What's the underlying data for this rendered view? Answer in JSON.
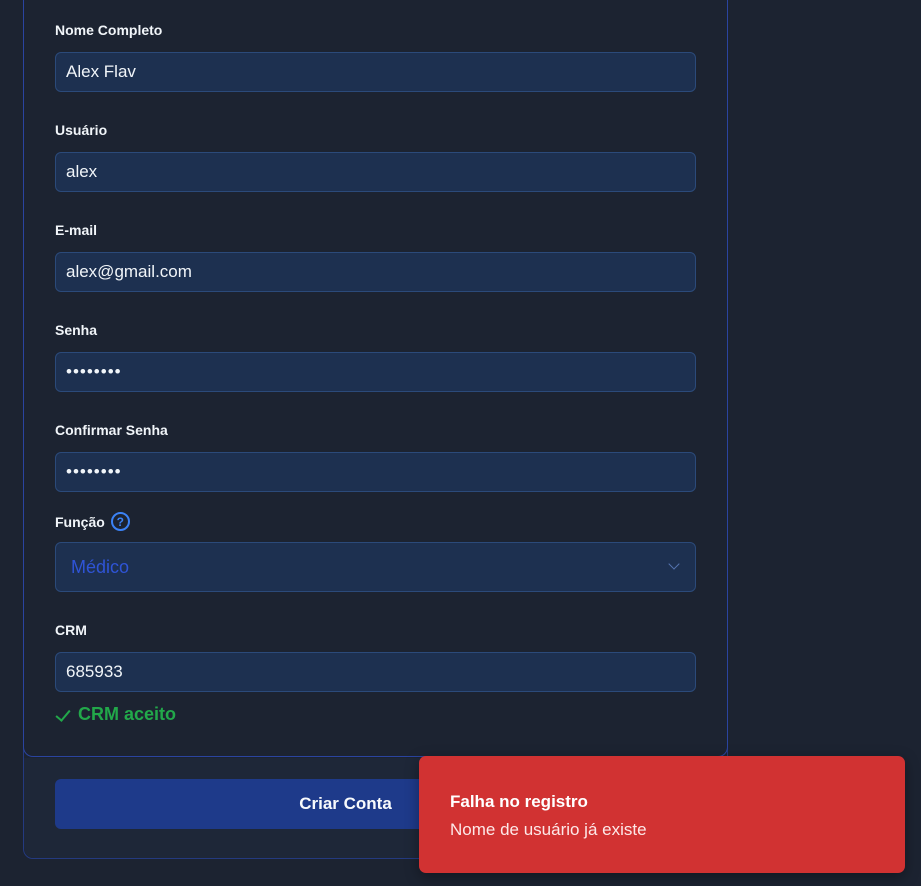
{
  "form": {
    "full_name": {
      "label": "Nome Completo",
      "value": "Alex Flav"
    },
    "username": {
      "label": "Usuário",
      "value": "alex"
    },
    "email": {
      "label": "E-mail",
      "value": "alex@gmail.com"
    },
    "password": {
      "label": "Senha",
      "value": "••••••••"
    },
    "confirm_password": {
      "label": "Confirmar Senha",
      "value": "••••••••"
    },
    "role": {
      "label": "Função",
      "help_icon": "?",
      "selected": "Médico"
    },
    "crm": {
      "label": "CRM",
      "value": "685933",
      "validation": "CRM aceito"
    },
    "submit_label": "Criar Conta"
  },
  "toast": {
    "title": "Falha no registro",
    "message": "Nome de usuário já existe"
  },
  "colors": {
    "background": "#1c2331",
    "field_bg": "#1d3050",
    "accent": "#1e3a8a",
    "success": "#22a84a",
    "error": "#d13232"
  }
}
